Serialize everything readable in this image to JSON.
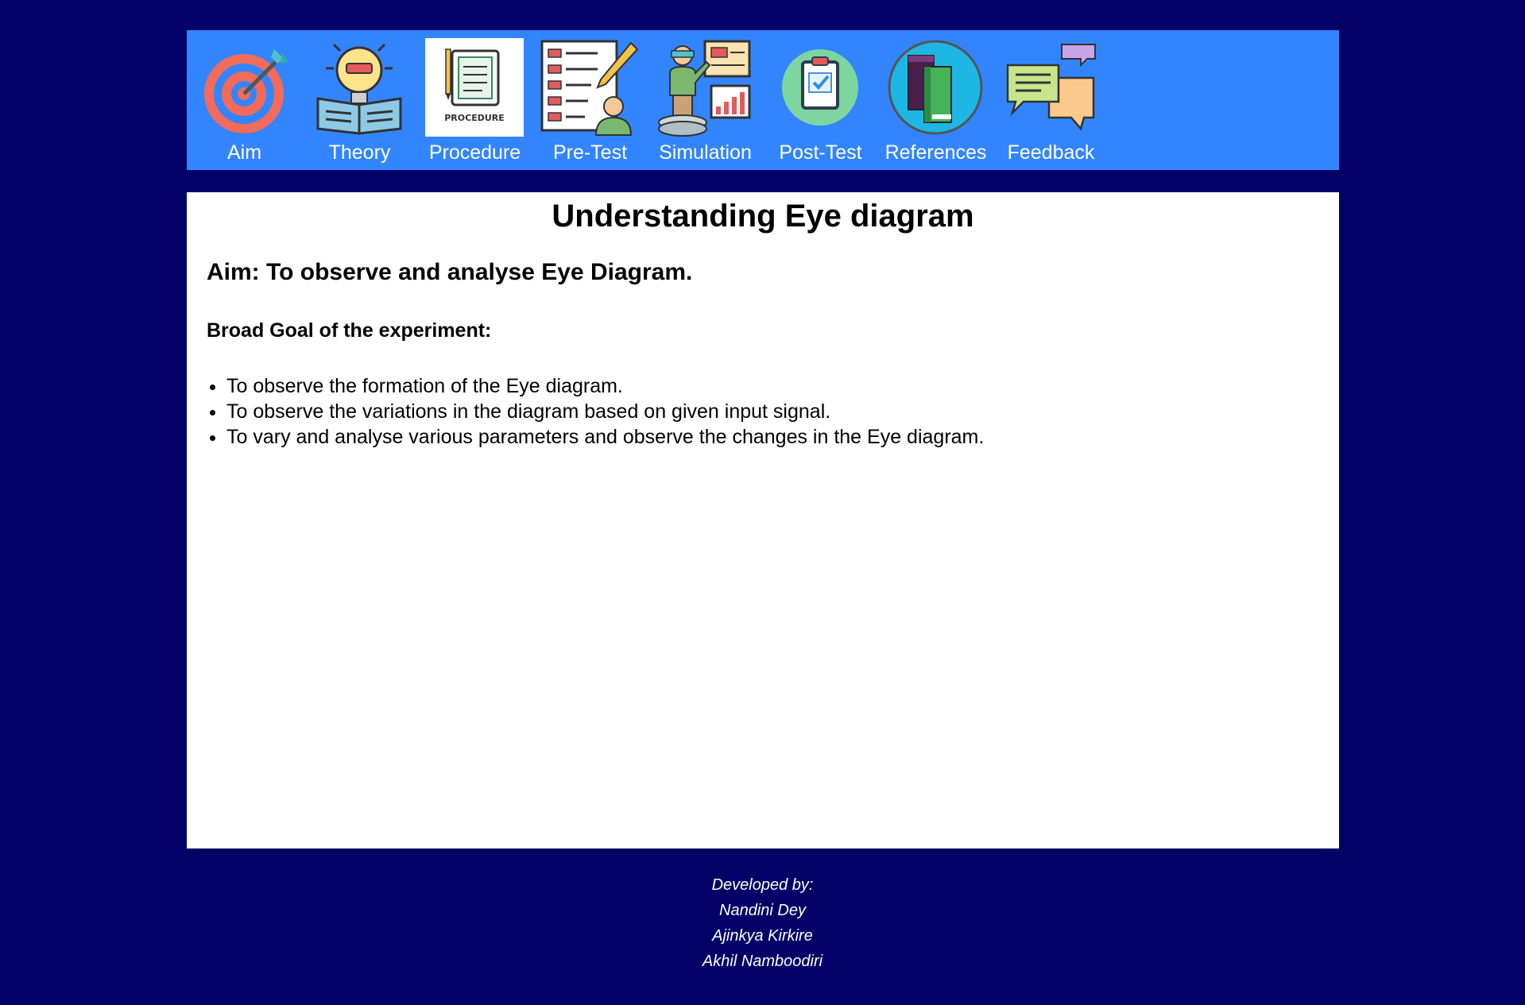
{
  "nav": {
    "items": [
      {
        "label": "Aim",
        "icon": "target-icon"
      },
      {
        "label": "Theory",
        "icon": "lightbulb-book-icon"
      },
      {
        "label": "Procedure",
        "icon": "procedure-document-icon",
        "icon_caption": "PROCEDURE"
      },
      {
        "label": "Pre-Test",
        "icon": "checklist-pencil-icon"
      },
      {
        "label": "Simulation",
        "icon": "presenter-chart-icon"
      },
      {
        "label": "Post-Test",
        "icon": "clipboard-check-icon"
      },
      {
        "label": "References",
        "icon": "books-icon"
      },
      {
        "label": "Feedback",
        "icon": "chat-bubbles-icon"
      }
    ]
  },
  "main": {
    "title": "Understanding Eye diagram",
    "aim": "Aim: To observe and analyse Eye Diagram.",
    "goal_heading": "Broad Goal of the experiment:",
    "goals": [
      "To observe the formation of the Eye diagram.",
      "To observe the variations in the diagram based on given input signal.",
      "To vary and analyse various parameters and observe the changes in the Eye diagram."
    ]
  },
  "footer": {
    "heading": "Developed by:",
    "developers": [
      "Nandini Dey",
      "Ajinkya Kirkire",
      "Akhil Namboodiri"
    ]
  },
  "colors": {
    "page_background": "#000066",
    "nav_background": "#3385ff",
    "content_background": "#ffffff",
    "nav_text": "#ffffff"
  }
}
